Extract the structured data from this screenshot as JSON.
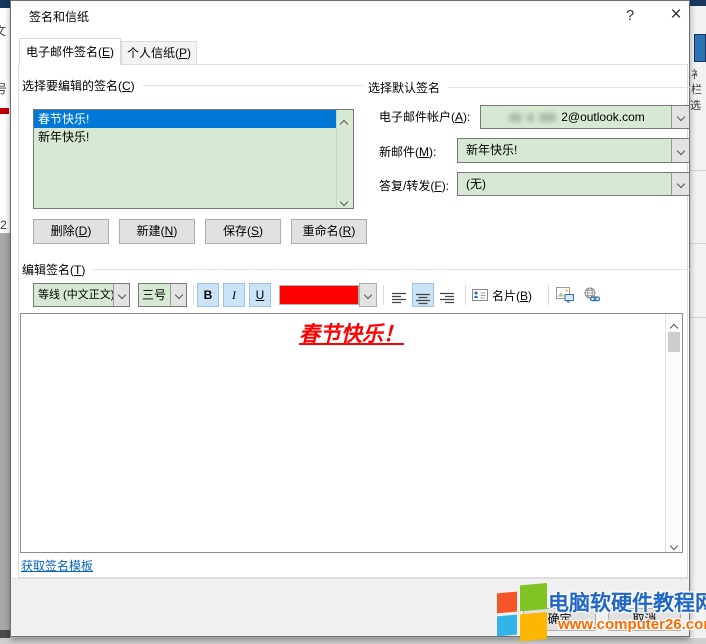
{
  "window": {
    "title": "签名和信纸",
    "help_label": "?",
    "close_label": "×"
  },
  "tabs": {
    "email": {
      "pre": "电子邮件签名(",
      "key": "E",
      "post": ")"
    },
    "stationery": {
      "pre": "个人信纸(",
      "key": "P",
      "post": ")"
    }
  },
  "signature_select": {
    "label": {
      "pre": "选择要编辑的签名(",
      "key": "C",
      "post": ")"
    },
    "items": [
      {
        "text": "春节快乐!",
        "selected": true
      },
      {
        "text": "新年快乐!",
        "selected": false
      }
    ],
    "buttons": {
      "delete": {
        "pre": "删除(",
        "key": "D",
        "post": ")"
      },
      "new": {
        "pre": "新建(",
        "key": "N",
        "post": ")"
      },
      "save": {
        "pre": "保存(",
        "key": "S",
        "post": ")"
      },
      "rename": {
        "pre": "重命名(",
        "key": "R",
        "post": ")"
      }
    }
  },
  "default_signature": {
    "header": "选择默认签名",
    "email_account": {
      "label": {
        "pre": "电子邮件帐户(",
        "key": "A",
        "post": "):"
      },
      "value_visible": "2@outlook.com",
      "value_redacted": true
    },
    "new_messages": {
      "label": {
        "pre": "新邮件(",
        "key": "M",
        "post": "):"
      },
      "value": "新年快乐!"
    },
    "replies": {
      "label": {
        "pre": "答复/转发(",
        "key": "F",
        "post": "):"
      },
      "value": "(无)"
    }
  },
  "edit_signature": {
    "label": {
      "pre": "编辑签名(",
      "key": "T",
      "post": ")"
    },
    "toolbar": {
      "font_name": "等线 (中文正文)",
      "font_size": "三号",
      "bold": "B",
      "italic": "I",
      "underline": "U",
      "font_color": "#ff0000",
      "business_card": {
        "pre": "名片(",
        "key": "B",
        "post": ")"
      },
      "icons": [
        "business-card-icon",
        "insert-picture-icon",
        "insert-hyperlink-icon"
      ]
    },
    "body_text": "春节快乐！"
  },
  "get_templates_link": "获取签名模板",
  "footer": {
    "ok": "确定",
    "cancel": "取消"
  },
  "watermark": {
    "site_name": "电脑软硬件教程网",
    "site_url": "www.computer26.com",
    "logo_colors": {
      "orange": "#f4562a",
      "green": "#7fc324",
      "blue": "#33b3e8",
      "yellow": "#fdb700"
    }
  },
  "background_fragments": {
    "left": [
      "文",
      "号",
      "2"
    ],
    "right": [
      "衤",
      "栏",
      "选"
    ]
  },
  "colors": {
    "field_green": "#d6e9d2",
    "selection_blue": "#0078d7",
    "link_blue": "#0563c1",
    "signature_red": "#ff0000",
    "watermark_blue": "#2166c4",
    "watermark_orange": "#ff6a00"
  }
}
